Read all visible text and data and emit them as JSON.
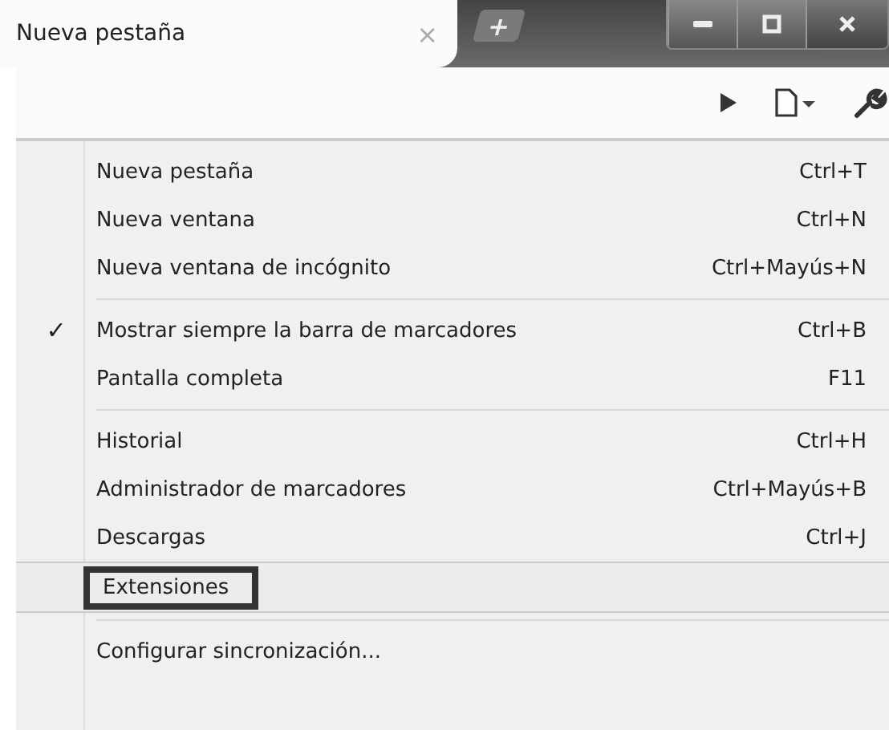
{
  "tab": {
    "title": "Nueva pestaña",
    "close": "×",
    "new_tab": "+"
  },
  "window_controls": [
    {
      "kind": "minimize"
    },
    {
      "kind": "maximize"
    },
    {
      "kind": "close"
    }
  ],
  "menu": {
    "groups": [
      [
        {
          "label": "Nueva pestaña",
          "shortcut": "Ctrl+T",
          "checked": false,
          "selected": false
        },
        {
          "label": "Nueva ventana",
          "shortcut": "Ctrl+N",
          "checked": false,
          "selected": false
        },
        {
          "label": "Nueva ventana de incógnito",
          "shortcut": "Ctrl+Mayús+N",
          "checked": false,
          "selected": false
        }
      ],
      [
        {
          "label": "Mostrar siempre la barra de marcadores",
          "shortcut": "Ctrl+B",
          "checked": true,
          "selected": false
        },
        {
          "label": "Pantalla completa",
          "shortcut": "F11",
          "checked": false,
          "selected": false
        }
      ],
      [
        {
          "label": "Historial",
          "shortcut": "Ctrl+H",
          "checked": false,
          "selected": false
        },
        {
          "label": "Administrador de marcadores",
          "shortcut": "Ctrl+Mayús+B",
          "checked": false,
          "selected": false
        },
        {
          "label": "Descargas",
          "shortcut": "Ctrl+J",
          "checked": false,
          "selected": false
        },
        {
          "label": "Extensiones",
          "checked": false,
          "selected": true
        }
      ],
      [
        {
          "label": "Configurar sincronización...",
          "checked": false,
          "selected": false
        }
      ]
    ],
    "check_mark": "✓"
  }
}
